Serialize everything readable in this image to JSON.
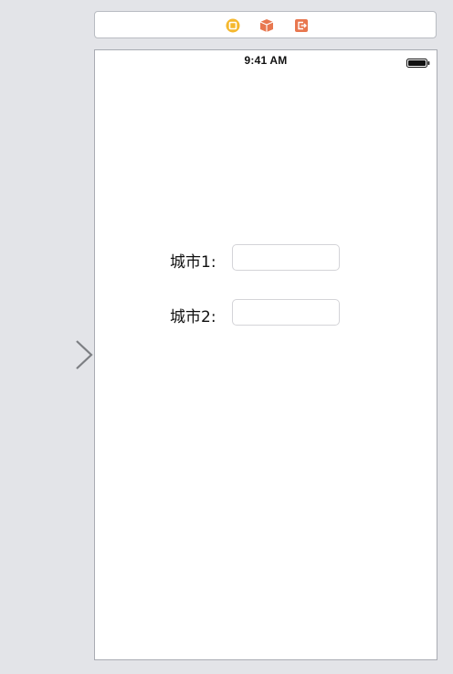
{
  "dock": {
    "icons": [
      "view-controller-icon",
      "first-responder-icon",
      "exit-icon"
    ],
    "colors": {
      "view_controller": "#f5b82e",
      "first_responder": "#e8774f",
      "exit": "#e8774f"
    }
  },
  "status_bar": {
    "time": "9:41 AM",
    "battery_level": 1.0
  },
  "form": {
    "city1": {
      "label": "城市1:",
      "value": "",
      "placeholder": ""
    },
    "city2": {
      "label": "城市2:",
      "value": "",
      "placeholder": ""
    }
  }
}
